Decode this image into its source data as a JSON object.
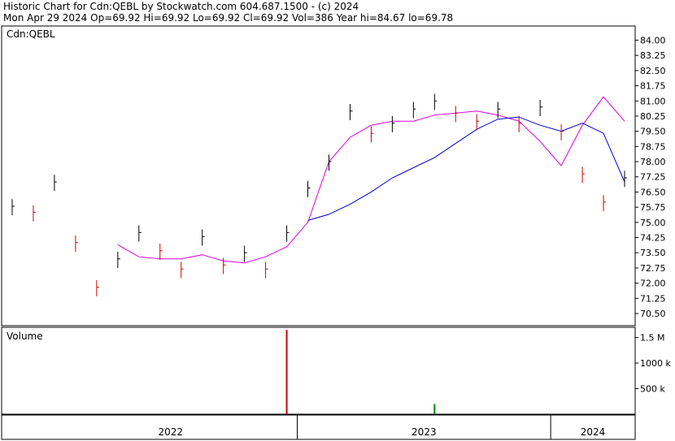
{
  "header": {
    "line1": "Historic Chart for Cdn:QEBL by Stockwatch.com 604.687.1500 - (c) 2024",
    "line2": "Mon Apr 29 2024   Op=69.92   Hi=69.92   Lo=69.92   Cl=69.92   Vol=386   Year hi=84.67   lo=69.78"
  },
  "price_panel": {
    "symbol_label": "Cdn:QEBL"
  },
  "volume_panel": {
    "title": "Volume"
  },
  "colors": {
    "up_bar": "#000000",
    "down_bar": "#cc0000",
    "ma_short": "#dd00dd",
    "ma_long": "#0000cc",
    "volume": "#cc0000",
    "volume_small": "#008800"
  },
  "chart_data": [
    {
      "type": "ohlc",
      "ylim": [
        69.9,
        84.7
      ],
      "y_ticks": [
        "84.00",
        "83.25",
        "82.50",
        "81.75",
        "81.00",
        "80.25",
        "79.50",
        "78.75",
        "78.00",
        "77.25",
        "76.50",
        "75.75",
        "75.00",
        "74.25",
        "73.50",
        "72.75",
        "72.00",
        "71.25",
        "70.50"
      ],
      "x_labels": [
        "2022",
        "2023",
        "2024"
      ],
      "x_range": [
        "2021-11",
        "2024-04"
      ],
      "series": [
        {
          "kind": "price",
          "points": [
            [
              "2021-11",
              75.8
            ],
            [
              "2021-12",
              75.5
            ],
            [
              "2022-01",
              77.0
            ],
            [
              "2022-02",
              74.0
            ],
            [
              "2022-03",
              71.8
            ],
            [
              "2022-04",
              73.2
            ],
            [
              "2022-05",
              74.5
            ],
            [
              "2022-06",
              73.6
            ],
            [
              "2022-07",
              72.7
            ],
            [
              "2022-08",
              74.3
            ],
            [
              "2022-09",
              72.9
            ],
            [
              "2022-10",
              73.5
            ],
            [
              "2022-11",
              72.7
            ],
            [
              "2022-12",
              74.5
            ],
            [
              "2023-01",
              76.7
            ],
            [
              "2023-02",
              78.0
            ],
            [
              "2023-03",
              80.5
            ],
            [
              "2023-04",
              79.4
            ],
            [
              "2023-05",
              79.9
            ],
            [
              "2023-06",
              80.6
            ],
            [
              "2023-07",
              81.0
            ],
            [
              "2023-08",
              80.4
            ],
            [
              "2023-09",
              80.0
            ],
            [
              "2023-10",
              80.6
            ],
            [
              "2023-11",
              79.9
            ],
            [
              "2023-12",
              80.7
            ],
            [
              "2024-01",
              79.5
            ],
            [
              "2024-02",
              77.4
            ],
            [
              "2024-03",
              76.0
            ],
            [
              "2024-04",
              77.2
            ]
          ]
        },
        {
          "name": "",
          "kind": "ma_short",
          "points": [
            [
              "2022-04",
              73.9
            ],
            [
              "2022-05",
              73.3
            ],
            [
              "2022-06",
              73.2
            ],
            [
              "2022-07",
              73.2
            ],
            [
              "2022-08",
              73.4
            ],
            [
              "2022-09",
              73.1
            ],
            [
              "2022-10",
              73.0
            ],
            [
              "2022-11",
              73.3
            ],
            [
              "2022-12",
              73.8
            ],
            [
              "2023-01",
              75.0
            ],
            [
              "2023-02",
              78.0
            ],
            [
              "2023-03",
              79.2
            ],
            [
              "2023-04",
              79.8
            ],
            [
              "2023-05",
              80.0
            ],
            [
              "2023-06",
              80.0
            ],
            [
              "2023-07",
              80.3
            ],
            [
              "2023-08",
              80.4
            ],
            [
              "2023-09",
              80.5
            ],
            [
              "2023-10",
              80.3
            ],
            [
              "2023-11",
              80.0
            ],
            [
              "2023-12",
              79.0
            ],
            [
              "2024-01",
              77.8
            ],
            [
              "2024-02",
              79.8
            ],
            [
              "2024-03",
              81.2
            ],
            [
              "2024-04",
              80.0
            ]
          ]
        },
        {
          "name": "",
          "kind": "ma_long",
          "points": [
            [
              "2023-01",
              75.1
            ],
            [
              "2023-02",
              75.4
            ],
            [
              "2023-03",
              75.9
            ],
            [
              "2023-04",
              76.5
            ],
            [
              "2023-05",
              77.2
            ],
            [
              "2023-06",
              77.7
            ],
            [
              "2023-07",
              78.2
            ],
            [
              "2023-08",
              78.9
            ],
            [
              "2023-09",
              79.6
            ],
            [
              "2023-10",
              80.1
            ],
            [
              "2023-11",
              80.2
            ],
            [
              "2023-12",
              79.8
            ],
            [
              "2024-01",
              79.5
            ],
            [
              "2024-02",
              79.9
            ],
            [
              "2024-03",
              79.4
            ],
            [
              "2024-04",
              77.0
            ]
          ]
        }
      ]
    },
    {
      "type": "bar",
      "title": "Volume",
      "y_ticks": [
        "1.5 M",
        "1000 k",
        "500 k"
      ],
      "ylim": [
        0,
        1700000
      ],
      "spikes": [
        {
          "date": "2022-12",
          "value": 1650000
        },
        {
          "date": "2023-07",
          "value": 200000
        }
      ]
    }
  ]
}
